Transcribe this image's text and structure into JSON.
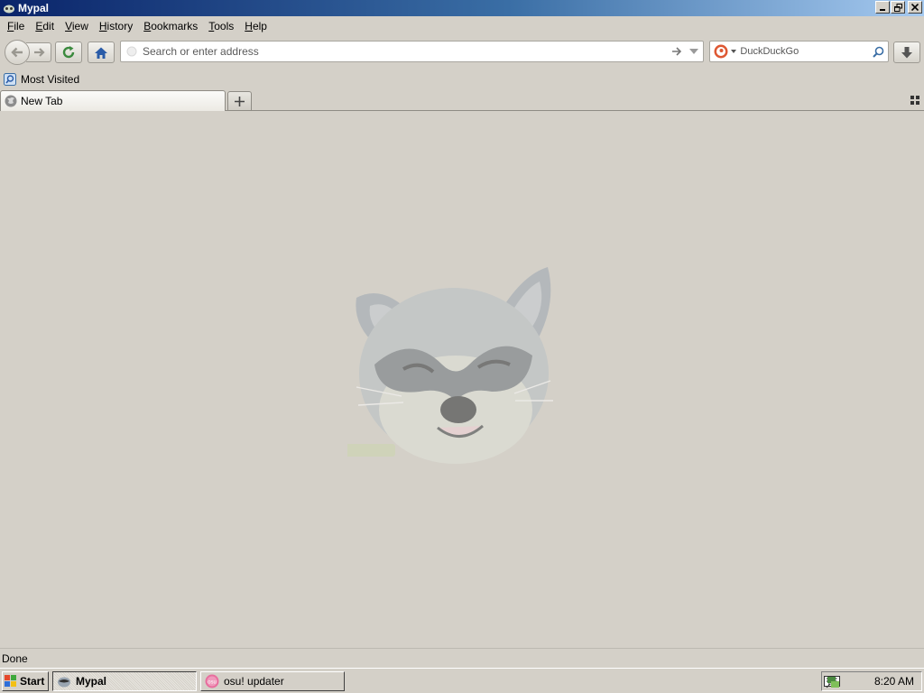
{
  "window": {
    "title": "Mypal"
  },
  "menubar": {
    "items": [
      {
        "label": "File",
        "accel": "F",
        "rest": "ile"
      },
      {
        "label": "Edit",
        "accel": "E",
        "rest": "dit"
      },
      {
        "label": "View",
        "accel": "V",
        "rest": "iew"
      },
      {
        "label": "History",
        "accel": "H",
        "rest": "istory"
      },
      {
        "label": "Bookmarks",
        "accel": "B",
        "rest": "ookmarks"
      },
      {
        "label": "Tools",
        "accel": "T",
        "rest": "ools"
      },
      {
        "label": "Help",
        "accel": "H",
        "rest": "elp"
      }
    ]
  },
  "navbar": {
    "url_placeholder": "Search or enter address",
    "url_value": "",
    "search_engine": "DuckDuckGo",
    "search_placeholder": "DuckDuckGo"
  },
  "bookmarks": {
    "most_visited": "Most Visited"
  },
  "tabs": [
    {
      "label": "New Tab"
    }
  ],
  "content": {
    "watermark_text": ""
  },
  "status": {
    "text": "Done"
  },
  "taskbar": {
    "start_label": "Start",
    "tasks": [
      {
        "label": "Mypal",
        "active": true
      },
      {
        "label": "osu! updater",
        "active": false
      }
    ],
    "clock": "8:20 AM"
  },
  "colors": {
    "titlebar_start": "#0a246a",
    "titlebar_end": "#a6caf0",
    "chrome": "#d4d0c8"
  }
}
